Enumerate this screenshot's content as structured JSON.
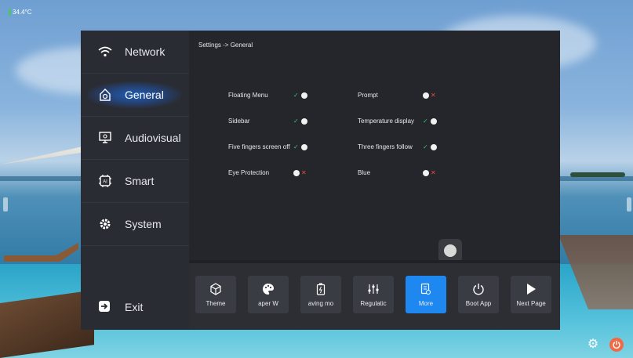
{
  "status": {
    "temperature": "34.4°C"
  },
  "nav": {
    "items": [
      {
        "label": "Network",
        "icon": "wifi-icon"
      },
      {
        "label": "General",
        "icon": "general-icon"
      },
      {
        "label": "Audiovisual",
        "icon": "monitor-icon"
      },
      {
        "label": "Smart",
        "icon": "ai-chip-icon"
      },
      {
        "label": "System",
        "icon": "system-gear-icon"
      }
    ],
    "active": "General",
    "exit_label": "Exit"
  },
  "breadcrumb": "Settings -> General",
  "settings": {
    "left": [
      {
        "label": "Floating Menu",
        "state": "on"
      },
      {
        "label": "Sidebar",
        "state": "on"
      },
      {
        "label": "Five fingers screen off",
        "state": "on"
      },
      {
        "label": "Eye Protection",
        "state": "off"
      }
    ],
    "right": [
      {
        "label": "Prompt",
        "state": "off"
      },
      {
        "label": "Temperature display",
        "state": "on"
      },
      {
        "label": "Three fingers follow",
        "state": "on"
      },
      {
        "label": "Blue",
        "state": "off"
      }
    ]
  },
  "dock": [
    {
      "label": "Theme",
      "icon": "cube-icon"
    },
    {
      "label": "aper   W",
      "icon": "palette-icon"
    },
    {
      "label": "aving mo",
      "icon": "battery-icon"
    },
    {
      "label": "Regulatic",
      "icon": "sliders-icon"
    },
    {
      "label": "More",
      "icon": "more-icon",
      "active": true
    },
    {
      "label": "Boot App",
      "icon": "power-icon"
    },
    {
      "label": "Next Page",
      "icon": "play-icon"
    }
  ],
  "colors": {
    "accent": "#1e88f0",
    "on": "#39c36b",
    "off": "#e84b3c",
    "power": "#f26a45"
  }
}
